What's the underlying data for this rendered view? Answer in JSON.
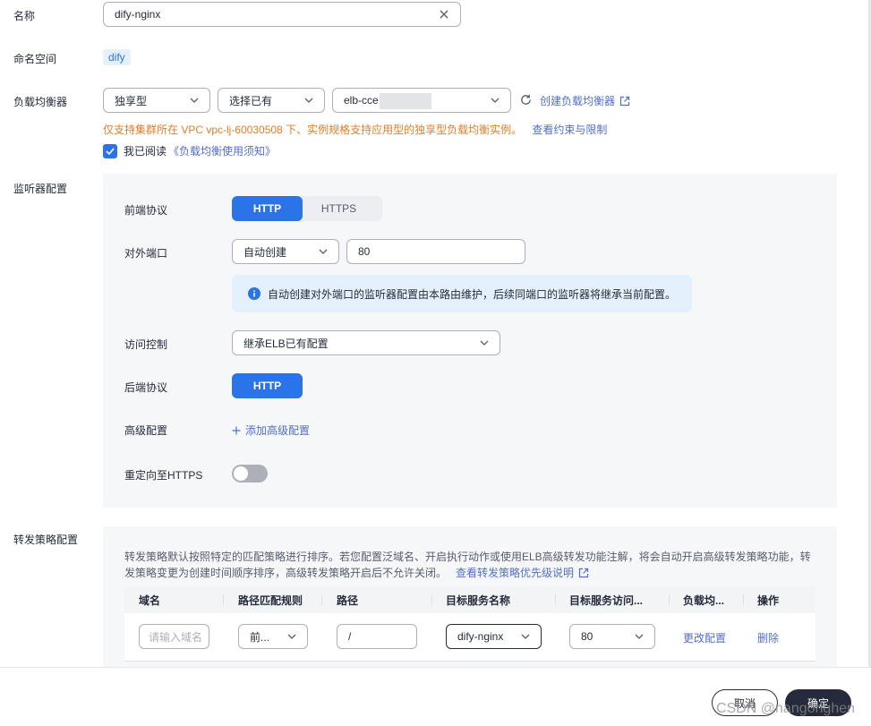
{
  "form": {
    "name": {
      "label": "名称",
      "value": "dify-nginx"
    },
    "namespace": {
      "label": "命名空间",
      "value": "dify"
    },
    "load_balancer": {
      "label": "负载均衡器",
      "type_value": "独享型",
      "mode_value": "选择已有",
      "instance_value": "elb-cce",
      "create_link": "创建负载均衡器",
      "warning": "仅支持集群所在 VPC vpc-lj-60030508 下、实例规格支持应用型的独享型负载均衡实例。",
      "constraint_link": "查看约束与限制",
      "agree_text": "我已阅读",
      "agree_link": "《负载均衡使用须知》",
      "agree_checked": true
    },
    "listener": {
      "label": "监听器配置",
      "frontend_protocol": {
        "label": "前端协议",
        "options": [
          "HTTP",
          "HTTPS"
        ],
        "selected": "HTTP"
      },
      "external_port": {
        "label": "对外端口",
        "mode_value": "自动创建",
        "port_value": "80"
      },
      "info_text": "自动创建对外端口的监听器配置由本路由维护，后续同端口的监听器将继承当前配置。",
      "access_control": {
        "label": "访问控制",
        "value": "继承ELB已有配置"
      },
      "backend_protocol": {
        "label": "后端协议",
        "value": "HTTP"
      },
      "advanced": {
        "label": "高级配置",
        "link": "添加高级配置"
      },
      "redirect_https": {
        "label": "重定向至HTTPS",
        "enabled": false
      }
    },
    "forwarding": {
      "label": "转发策略配置",
      "desc_line1": "转发策略默认按照特定的匹配策略进行排序。若您配置泛域名、开启执行动作或使用ELB高级转发功能注解，将会自动开启高级转发策略功能，转",
      "desc_line2": "发策略变更为创建时间顺序排序，高级转发策略开启后不允许关闭。",
      "priority_link": "查看转发策略优先级说明",
      "table": {
        "headers": [
          "域名",
          "路径匹配规则",
          "路径",
          "目标服务名称",
          "目标服务访问...",
          "负载均...",
          "操作"
        ],
        "row": {
          "domain_placeholder": "请输入域名",
          "match_rule": "前...",
          "path": "/",
          "service": "dify-nginx",
          "port": "80",
          "edit_link": "更改配置",
          "delete_link": "删除"
        }
      }
    }
  },
  "footer": {
    "cancel": "取消",
    "confirm": "确定"
  },
  "watermark": "CSDN @nangonghen",
  "colors": {
    "primary": "#2b73e8",
    "link": "#526ecc",
    "warning": "#e37d29",
    "panel_bg": "#f6f7f9",
    "info_bg": "#e5f0fd"
  }
}
